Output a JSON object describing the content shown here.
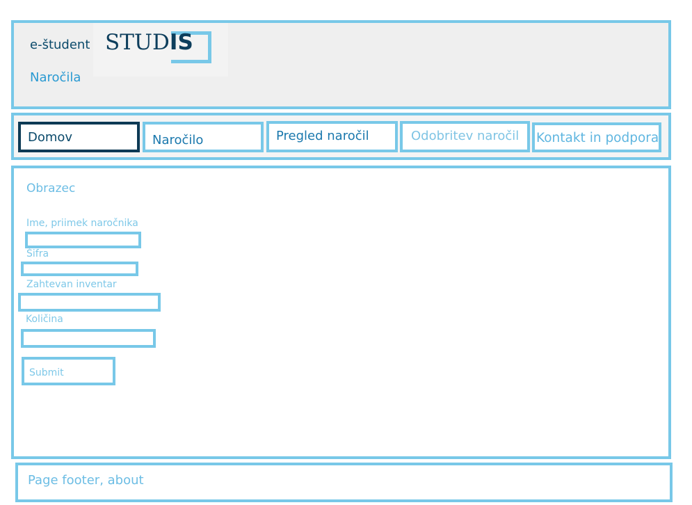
{
  "header": {
    "app_title": "e-študent",
    "subtitle": "Naročila",
    "logo": {
      "text_plain": "STUD",
      "text_bold": "IS",
      "icon": "studis-logo"
    }
  },
  "nav": {
    "tabs": [
      {
        "label": "Domov",
        "active": true
      },
      {
        "label": "Naročilo"
      },
      {
        "label": "Pregled naročil"
      },
      {
        "label": "Odobritev naročil"
      },
      {
        "label": "Kontakt in podpora"
      }
    ]
  },
  "form": {
    "title": "Obrazec",
    "fields": [
      {
        "label": "Ime, priimek naročnika",
        "value": ""
      },
      {
        "label": "Šifra",
        "value": ""
      },
      {
        "label": "Zahtevan inventar",
        "value": ""
      },
      {
        "label": "Količina",
        "value": ""
      }
    ],
    "submit_label": "Submit"
  },
  "footer": {
    "text": "Page footer, about"
  },
  "colors": {
    "accent": "#78c8e8",
    "dark": "#0d3a55",
    "link": "#1a78ad"
  }
}
